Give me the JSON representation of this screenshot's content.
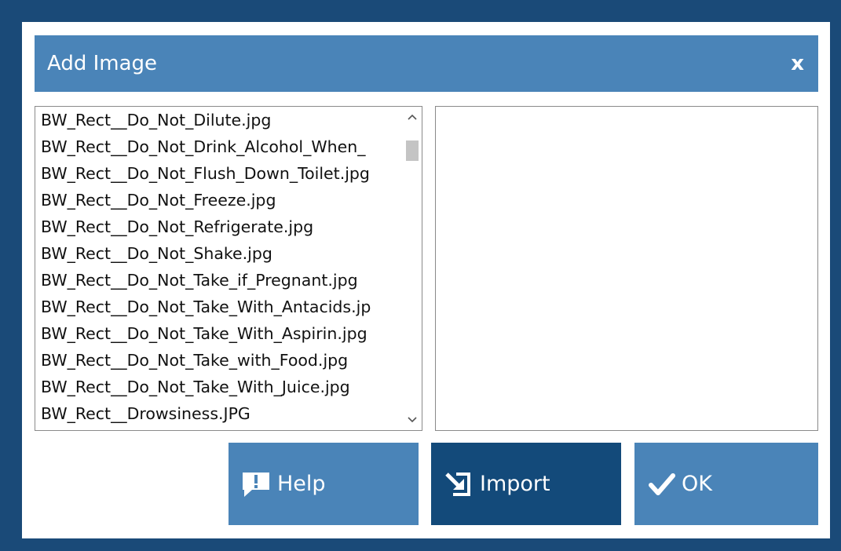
{
  "dialog": {
    "title": "Add Image",
    "close_label": "x"
  },
  "file_list": {
    "items": [
      "BW_Rect__Do_Not_Dilute.jpg",
      "BW_Rect__Do_Not_Drink_Alcohol_When_",
      "BW_Rect__Do_Not_Flush_Down_Toilet.jpg",
      "BW_Rect__Do_Not_Freeze.jpg",
      "BW_Rect__Do_Not_Refrigerate.jpg",
      "BW_Rect__Do_Not_Shake.jpg",
      "BW_Rect__Do_Not_Take_if_Pregnant.jpg",
      "BW_Rect__Do_Not_Take_With_Antacids.jp",
      "BW_Rect__Do_Not_Take_With_Aspirin.jpg",
      "BW_Rect__Do_Not_Take_with_Food.jpg",
      "BW_Rect__Do_Not_Take_With_Juice.jpg",
      "BW_Rect__Drowsiness.JPG"
    ]
  },
  "buttons": {
    "help_label": "Help",
    "help_icon": "help-sign-icon",
    "import_label": "Import",
    "import_icon": "import-arrow-icon",
    "ok_label": "OK",
    "ok_icon": "checkmark-icon"
  },
  "colors": {
    "frame": "#1a4a78",
    "titlebar": "#4a84b8",
    "button_light": "#4a84b8",
    "button_dark": "#134a7a"
  }
}
